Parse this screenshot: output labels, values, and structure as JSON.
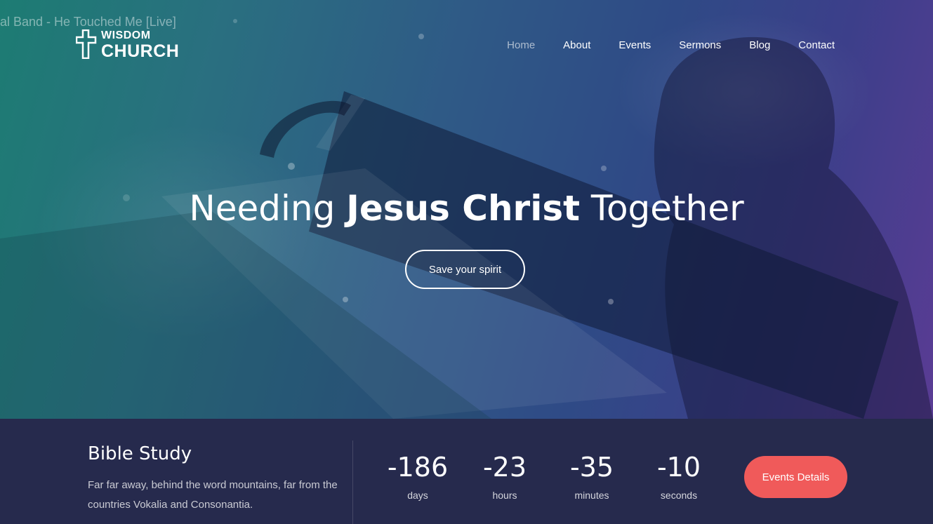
{
  "video_overlay": {
    "title": "al Band - He Touched Me [Live]"
  },
  "logo": {
    "line1": "WISDOM",
    "line2": "CHURCH"
  },
  "nav": {
    "items": [
      "Home",
      "About",
      "Events",
      "Sermons",
      "Blog",
      "Contact"
    ],
    "active": "Home"
  },
  "hero": {
    "headline_pre": "Needing ",
    "headline_bold": "Jesus Christ",
    "headline_post": " Together",
    "cta_label": "Save your spirit"
  },
  "event": {
    "title": "Bible Study",
    "description": "Far far away, behind the word mountains, far from the countries Vokalia and Consonantia.",
    "countdown": {
      "days": "-186",
      "days_label": "days",
      "hours": "-23",
      "hours_label": "hours",
      "minutes": "-35",
      "minutes_label": "minutes",
      "seconds": "-10",
      "seconds_label": "seconds"
    },
    "button_label": "Events Details"
  },
  "colors": {
    "accent": "#f05a5a",
    "bar_bg": "#262a4d"
  }
}
